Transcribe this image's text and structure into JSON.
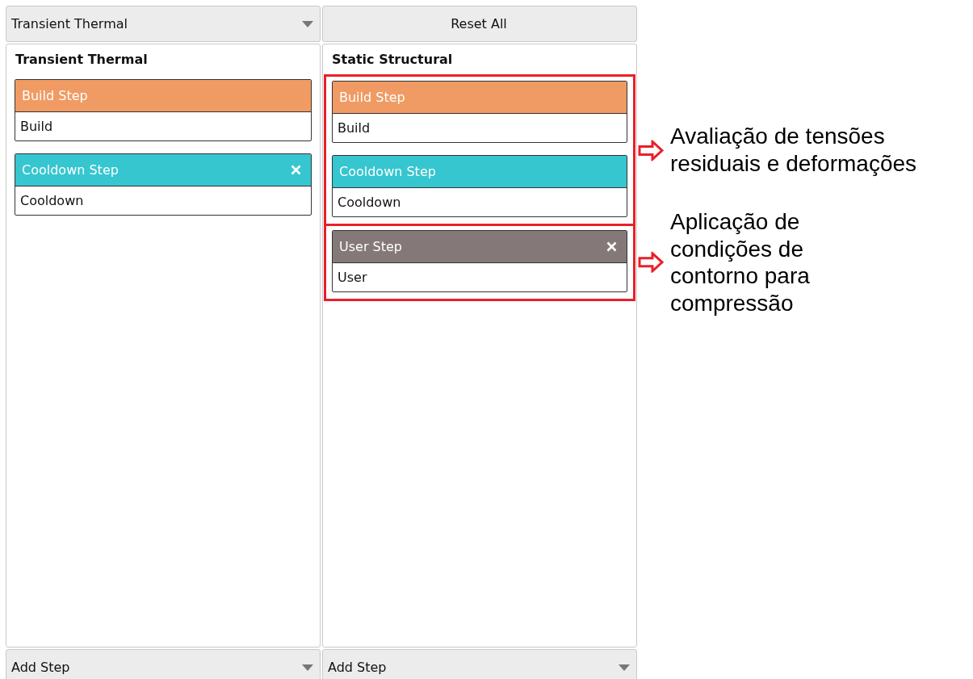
{
  "columns": [
    {
      "selector": {
        "kind": "dropdown",
        "label": "Transient Thermal"
      },
      "title": "Transient Thermal",
      "groups": [
        {
          "highlighted": false,
          "steps": [
            {
              "title": "Build Step",
              "body": "Build",
              "color": "#f09b63",
              "removable": false
            },
            {
              "title": "Cooldown Step",
              "body": "Cooldown",
              "color": "#36c6d0",
              "removable": true
            }
          ]
        }
      ],
      "add_step": "Add Step"
    },
    {
      "selector": {
        "kind": "button",
        "label": "Reset All"
      },
      "title": "Static Structural",
      "groups": [
        {
          "highlighted": true,
          "annotation": "Avaliação de tensões\nresiduais e deformações",
          "steps": [
            {
              "title": "Build Step",
              "body": "Build",
              "color": "#f09b63",
              "removable": false
            },
            {
              "title": "Cooldown Step",
              "body": "Cooldown",
              "color": "#36c6d0",
              "removable": false
            }
          ]
        },
        {
          "highlighted": true,
          "annotation": "Aplicação de\ncondições de\ncontorno para\ncompressão",
          "steps": [
            {
              "title": "User Step",
              "body": "User",
              "color": "#857878",
              "removable": true
            }
          ]
        }
      ],
      "add_step": "Add Step"
    }
  ]
}
